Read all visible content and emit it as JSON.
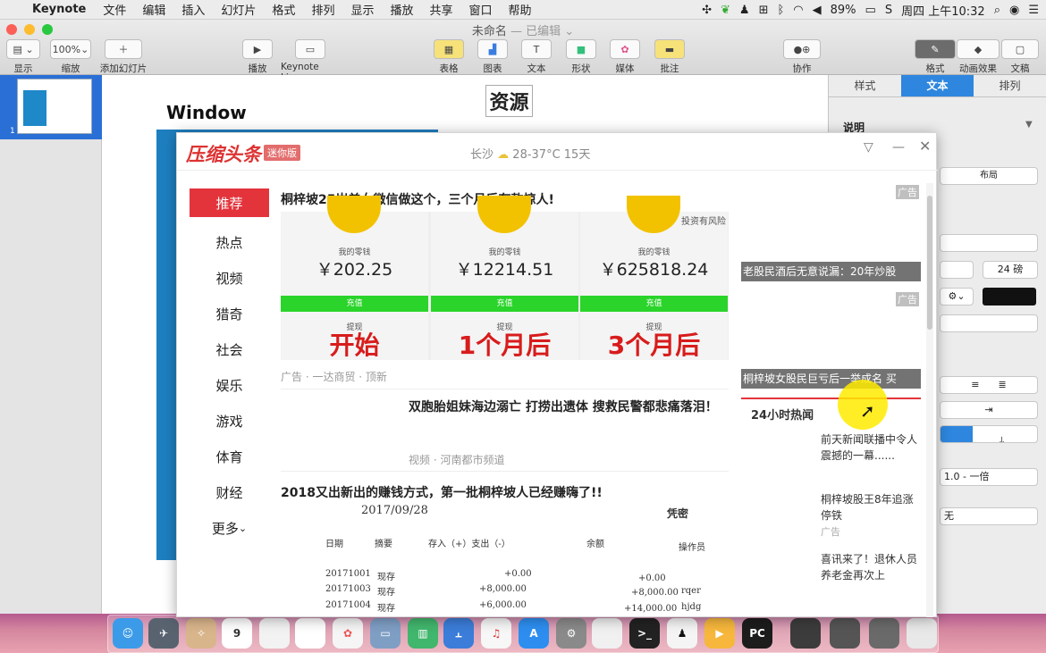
{
  "menubar": {
    "app_name": "Keynote",
    "items": [
      "文件",
      "编辑",
      "插入",
      "幻灯片",
      "格式",
      "排列",
      "显示",
      "播放",
      "共享",
      "窗口",
      "帮助"
    ],
    "battery": "89%",
    "clock": "周四 上午10:32"
  },
  "toolbar": {
    "doc_title": "未命名",
    "doc_status": "— 已编辑",
    "view_label": "显示",
    "zoom_value": "100%",
    "zoom_label": "缩放",
    "add_slide_label": "添加幻灯片",
    "play_label": "播放",
    "keynote_live_label": "Keynote Live",
    "table_label": "表格",
    "chart_label": "图表",
    "text_label": "文本",
    "shape_label": "形状",
    "media_label": "媒体",
    "comment_label": "批注",
    "collab_label": "协作",
    "format_label": "格式",
    "animate_label": "动画效果",
    "document_label": "文稿"
  },
  "slidenav": {
    "slide_number": "1"
  },
  "slide": {
    "resource_text": "资源",
    "window_text": "Window"
  },
  "inspector": {
    "tabs": [
      "样式",
      "文本",
      "排列"
    ],
    "section": "说明",
    "layout_btn": "布局",
    "font_size": "24 磅",
    "spacing": "1.0 - 一倍",
    "bullets": "无"
  },
  "popup": {
    "logo": "压缩头条",
    "badge": "迷你版",
    "city": "长沙",
    "weather": "28-37°C 15天",
    "categories": [
      "推荐",
      "热点",
      "视频",
      "猎奇",
      "社会",
      "娱乐",
      "游戏",
      "体育",
      "财经",
      "更多"
    ],
    "feed": {
      "item1_title": "桐梓坡25岁美女微信做这个，三个月后存款惊人!",
      "ad_risk": "投资有风险",
      "ad_cols": [
        {
          "label": "我的零钱",
          "amount": "￥202.25",
          "btn": "充值",
          "tx": "提现",
          "big": "开始"
        },
        {
          "label": "我的零钱",
          "amount": "￥12214.51",
          "btn": "充值",
          "tx": "提现",
          "big": "1个月后"
        },
        {
          "label": "我的零钱",
          "amount": "￥625818.24",
          "btn": "充值",
          "tx": "提现",
          "big": "3个月后"
        }
      ],
      "item1_meta": "广告 · 一达商贸 · 顶新",
      "item2_title": "双胞胎姐妹海边溺亡 打捞出遗体 搜救民警都悲痛落泪！",
      "item2_meta": "视频 · 河南都市频道",
      "item3_title": "2018又出新出的赚钱方式，第一批桐梓坡人已经赚嗨了!!",
      "ledger_date": "2017/09/28",
      "ledger_stamp": "凭密",
      "ledger_headers": [
        "日期",
        "摘要",
        "存入（+）支出（-）",
        "余额",
        "操作员"
      ],
      "ledger_rows": [
        [
          "20171001",
          "现存",
          "+0.00",
          "+0.00",
          ""
        ],
        [
          "20171003",
          "现存",
          "+8,000.00",
          "+8,000.00",
          "rqer"
        ],
        [
          "20171004",
          "现存",
          "+6,000.00",
          "+14,000.00",
          "hjdg"
        ]
      ]
    },
    "right": {
      "ad1_tag": "广告",
      "ad1_caption": "老股民酒后无意说漏：20年炒股",
      "ad2_tag": "广告",
      "ad2_caption": "桐梓坡女股民巨亏后一举成名 买",
      "hot_title": "24小时热闻",
      "hot_items": [
        {
          "text": "前天新闻联播中令人震撼的一幕......",
          "tag": ""
        },
        {
          "text": "桐梓坡股王8年追涨停铁",
          "tag": "广告"
        },
        {
          "text": "喜讯来了！退休人员养老金再次上",
          "tag": ""
        }
      ]
    }
  },
  "dock": {
    "calendar_day": "9"
  }
}
